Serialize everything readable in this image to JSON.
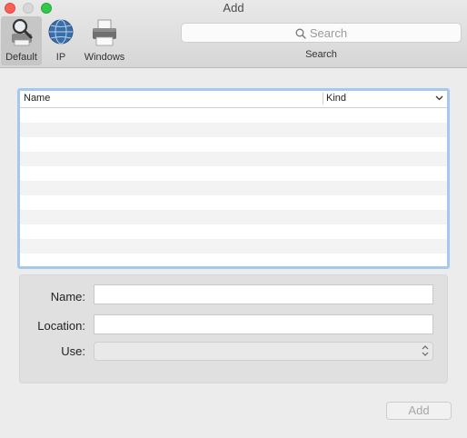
{
  "window": {
    "title": "Add"
  },
  "toolbar": {
    "items": [
      {
        "label": "Default",
        "icon": "magnifier-printer-icon",
        "selected": true
      },
      {
        "label": "IP",
        "icon": "globe-icon",
        "selected": false
      },
      {
        "label": "Windows",
        "icon": "printer-icon",
        "selected": false
      }
    ],
    "search": {
      "placeholder": "Search",
      "label": "Search"
    }
  },
  "table": {
    "columns": [
      "Name",
      "Kind"
    ],
    "rows": []
  },
  "form": {
    "name_label": "Name:",
    "name_value": "",
    "location_label": "Location:",
    "location_value": "",
    "use_label": "Use:",
    "use_value": ""
  },
  "buttons": {
    "add_label": "Add"
  },
  "colors": {
    "close": "#fc5f57",
    "minimize": "#d7d7d7",
    "zoom": "#34c84a",
    "table_focus_ring": "#a6c8ed"
  }
}
